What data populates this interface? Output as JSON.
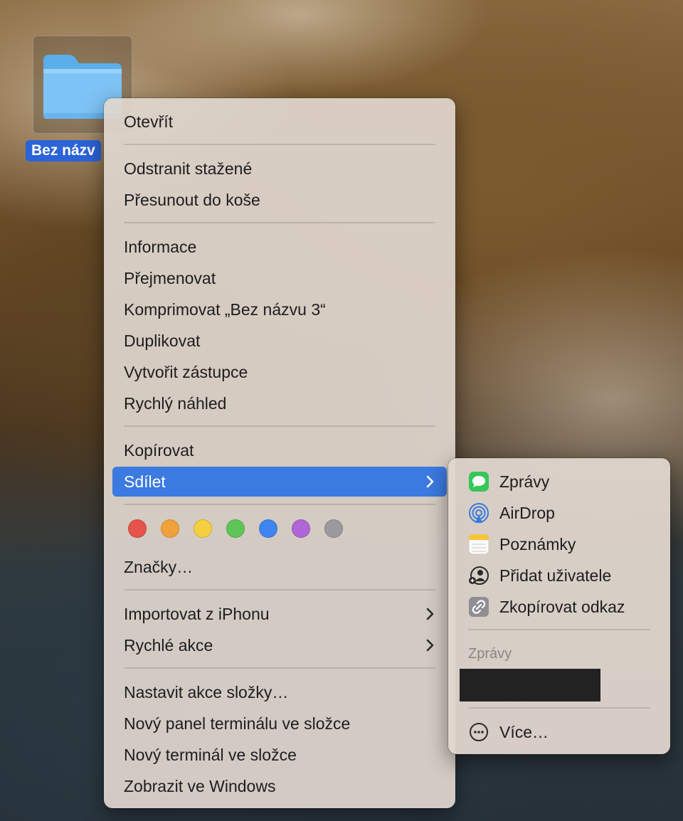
{
  "desktop": {
    "folder_label": "Bez názv"
  },
  "menu": {
    "open": "Otevřít",
    "remove_download": "Odstranit stažené",
    "move_trash": "Přesunout do koše",
    "info": "Informace",
    "rename": "Přejmenovat",
    "compress": "Komprimovat „Bez názvu 3“",
    "duplicate": "Duplikovat",
    "alias": "Vytvořit zástupce",
    "quicklook": "Rychlý náhled",
    "copy": "Kopírovat",
    "share": "Sdílet",
    "tags_label": "Značky…",
    "import_iphone": "Importovat z iPhonu",
    "quick_actions": "Rychlé akce",
    "folder_actions": "Nastavit akce složky…",
    "new_terminal_tab": "Nový panel terminálu ve složce",
    "new_terminal": "Nový terminál ve složce",
    "show_windows": "Zobrazit ve Windows"
  },
  "tag_colors": [
    "#e5534b",
    "#f0a13a",
    "#f4cf3f",
    "#5fc556",
    "#3f85f0",
    "#b065d8",
    "#9a9a9e"
  ],
  "share_submenu": {
    "messages": "Zprávy",
    "airdrop": "AirDrop",
    "notes": "Poznámky",
    "add_people": "Přidat uživatele",
    "copy_link": "Zkopírovat odkaz",
    "section_header": "Zprávy",
    "more": "Více…"
  },
  "colors": {
    "highlight": "#3b7ae0",
    "selection_label": "#2b63d8"
  }
}
